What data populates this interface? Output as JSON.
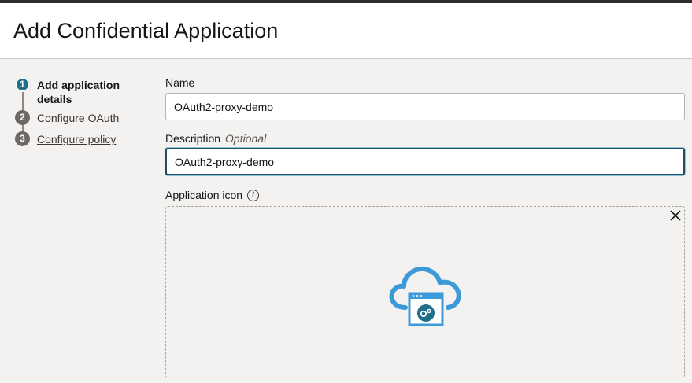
{
  "page": {
    "title": "Add Confidential Application"
  },
  "steps": [
    {
      "number": "1",
      "label": "Add application details",
      "active": true
    },
    {
      "number": "2",
      "label": "Configure OAuth",
      "active": false
    },
    {
      "number": "3",
      "label": "Configure policy",
      "active": false
    }
  ],
  "form": {
    "name": {
      "label": "Name",
      "value": "OAuth2-proxy-demo"
    },
    "description": {
      "label": "Description",
      "optional": "Optional",
      "value": "OAuth2-proxy-demo"
    },
    "application_icon": {
      "label": "Application icon",
      "info_icon": "info-icon",
      "close_icon": "close-icon",
      "placeholder_icon": "cloud-application-icon"
    }
  },
  "colors": {
    "accent": "#227e9e",
    "icon_blue": "#3d9ad8",
    "dark_teal": "#1f6e8a"
  }
}
